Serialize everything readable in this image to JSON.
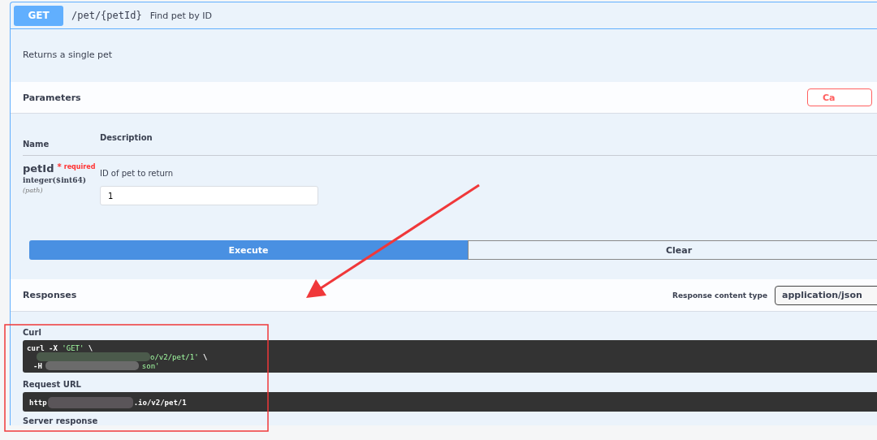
{
  "operation": {
    "method": "GET",
    "path": "/pet/{petId}",
    "summary": "Find pet by ID",
    "description": "Returns a single pet"
  },
  "parameters": {
    "title": "Parameters",
    "cancel_label": "Ca",
    "columns": [
      "Name",
      "Description"
    ],
    "rows": [
      {
        "name": "petId",
        "required_mark": "*",
        "required_label": "required",
        "type": "integer($int64)",
        "location": "(path)",
        "description": "ID of pet to return",
        "value": "1"
      }
    ]
  },
  "actions": [
    {
      "label": "Execute",
      "kind": "primary"
    },
    {
      "label": "Clear",
      "kind": "secondary"
    }
  ],
  "responses": {
    "title": "Responses",
    "content_type_label": "Response content type",
    "content_type": "application/json",
    "curl_label": "Curl",
    "curl_lines": [
      [
        {
          "kind": "plain",
          "text": "curl -X "
        },
        {
          "kind": "string",
          "text": "'GET'"
        },
        {
          "kind": "plain",
          "text": " \\"
        }
      ],
      [
        {
          "kind": "redaction"
        },
        {
          "kind": "string",
          "text": "o/v2/pet/1'"
        },
        {
          "kind": "plain",
          "text": " \\"
        }
      ],
      [
        {
          "kind": "plain",
          "text": "-H"
        },
        {
          "kind": "redaction"
        },
        {
          "kind": "string",
          "text": "son'"
        }
      ]
    ],
    "request_url_label": "Request URL",
    "request_url": [
      {
        "kind": "plain",
        "text": "http"
      },
      {
        "kind": "redaction"
      },
      {
        "kind": "plain",
        "text": ".io/v2/pet/1"
      }
    ],
    "server_response_label": "Server response"
  }
}
